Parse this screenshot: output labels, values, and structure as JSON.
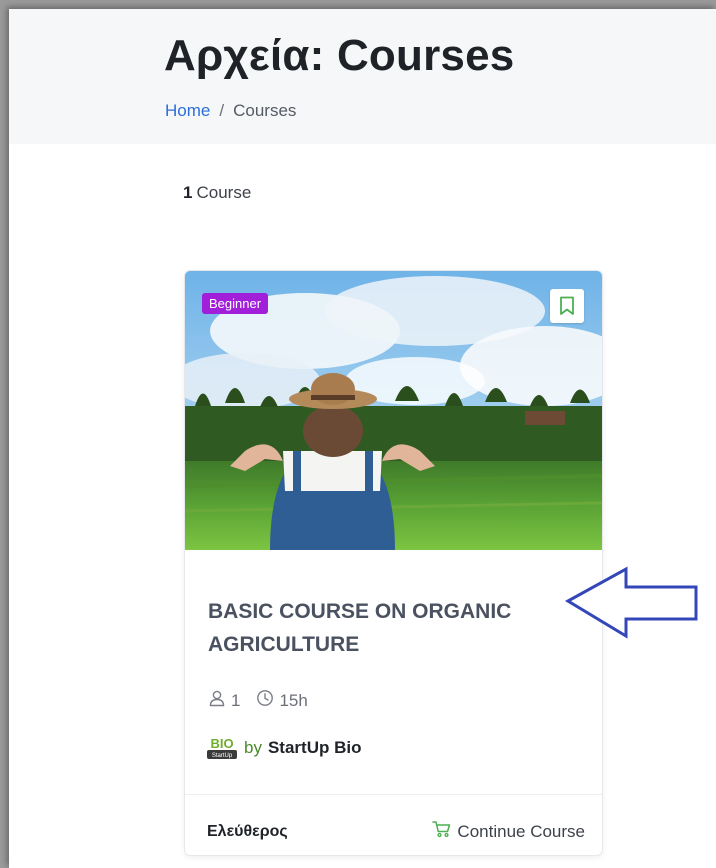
{
  "header": {
    "title": "Αρχεία: Courses",
    "breadcrumb": {
      "home": "Home",
      "separator": "/",
      "current": "Courses"
    }
  },
  "listing": {
    "count_number": "1",
    "count_label": "Course"
  },
  "course_card": {
    "level": "Beginner",
    "title": "BASIC COURSE ON ORGANIC AGRICULTURE",
    "students": "1",
    "duration": "15h",
    "author_prefix": "by",
    "author_name": "StartUp Bio",
    "logo_text_top": "BIO",
    "logo_text_bottom": "StartUp",
    "price": "Ελεύθερος",
    "action_label": "Continue Course",
    "icons": {
      "bookmark": "bookmark-icon",
      "students": "user-icon",
      "duration": "clock-icon",
      "action": "cart-icon"
    }
  },
  "colors": {
    "level_badge": "#a11fd9",
    "breadcrumb_link": "#2c6fd6",
    "author_prefix": "#4a8a2b",
    "annotation_arrow": "#3447b8",
    "bookmark_icon": "#4caf50"
  }
}
